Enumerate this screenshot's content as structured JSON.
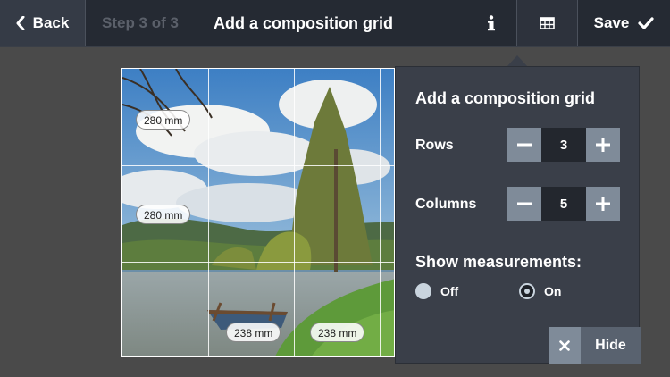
{
  "topbar": {
    "back_label": "Back",
    "step_label": "Step 3 of 3",
    "title": "Add a composition grid",
    "save_label": "Save"
  },
  "photo": {
    "measurements": {
      "row1": "280 mm",
      "row2": "280 mm",
      "col1": "238 mm",
      "col2": "238 mm"
    }
  },
  "popover": {
    "title": "Add a composition grid",
    "rows_label": "Rows",
    "rows_value": "3",
    "columns_label": "Columns",
    "columns_value": "5",
    "show_measurements_label": "Show measurements:",
    "off_label": "Off",
    "on_label": "On",
    "selected": "On",
    "hide_label": "Hide"
  },
  "colors": {
    "topbar": "#252a33",
    "panel": "#3a3f49",
    "stepper_button": "#7f8b99",
    "background": "#4a4a4a"
  },
  "icons": [
    "chevron-left-icon",
    "info-icon",
    "grid-icon",
    "checkmark-icon",
    "minus-icon",
    "plus-icon",
    "close-icon"
  ]
}
